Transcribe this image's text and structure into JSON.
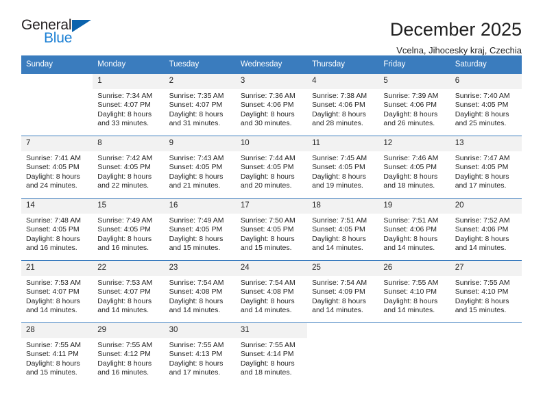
{
  "brand": {
    "name_top": "General",
    "name_bottom": "Blue",
    "triangle_icon": "triangle-logo-icon",
    "colors": {
      "dark": "#231f20",
      "blue": "#1a7fd4",
      "triangle": "#0b63ad"
    }
  },
  "header": {
    "title": "December 2025",
    "subtitle": "Vcelna, Jihocesky kraj, Czechia"
  },
  "theme": {
    "header_bg": "#3a7cbe",
    "header_text": "#ffffff",
    "daynum_bg": "#f2f2f2",
    "row_border": "#3a7cbe"
  },
  "weekday_headers": [
    "Sunday",
    "Monday",
    "Tuesday",
    "Wednesday",
    "Thursday",
    "Friday",
    "Saturday"
  ],
  "labels": {
    "sunrise_prefix": "Sunrise:",
    "sunset_prefix": "Sunset:",
    "daylight_prefix": "Daylight:"
  },
  "weeks": [
    [
      {
        "day": "",
        "empty": true
      },
      {
        "day": "1",
        "sunrise": "Sunrise: 7:34 AM",
        "sunset": "Sunset: 4:07 PM",
        "daylight_line1": "Daylight: 8 hours",
        "daylight_line2": "and 33 minutes."
      },
      {
        "day": "2",
        "sunrise": "Sunrise: 7:35 AM",
        "sunset": "Sunset: 4:07 PM",
        "daylight_line1": "Daylight: 8 hours",
        "daylight_line2": "and 31 minutes."
      },
      {
        "day": "3",
        "sunrise": "Sunrise: 7:36 AM",
        "sunset": "Sunset: 4:06 PM",
        "daylight_line1": "Daylight: 8 hours",
        "daylight_line2": "and 30 minutes."
      },
      {
        "day": "4",
        "sunrise": "Sunrise: 7:38 AM",
        "sunset": "Sunset: 4:06 PM",
        "daylight_line1": "Daylight: 8 hours",
        "daylight_line2": "and 28 minutes."
      },
      {
        "day": "5",
        "sunrise": "Sunrise: 7:39 AM",
        "sunset": "Sunset: 4:06 PM",
        "daylight_line1": "Daylight: 8 hours",
        "daylight_line2": "and 26 minutes."
      },
      {
        "day": "6",
        "sunrise": "Sunrise: 7:40 AM",
        "sunset": "Sunset: 4:05 PM",
        "daylight_line1": "Daylight: 8 hours",
        "daylight_line2": "and 25 minutes."
      }
    ],
    [
      {
        "day": "7",
        "sunrise": "Sunrise: 7:41 AM",
        "sunset": "Sunset: 4:05 PM",
        "daylight_line1": "Daylight: 8 hours",
        "daylight_line2": "and 24 minutes."
      },
      {
        "day": "8",
        "sunrise": "Sunrise: 7:42 AM",
        "sunset": "Sunset: 4:05 PM",
        "daylight_line1": "Daylight: 8 hours",
        "daylight_line2": "and 22 minutes."
      },
      {
        "day": "9",
        "sunrise": "Sunrise: 7:43 AM",
        "sunset": "Sunset: 4:05 PM",
        "daylight_line1": "Daylight: 8 hours",
        "daylight_line2": "and 21 minutes."
      },
      {
        "day": "10",
        "sunrise": "Sunrise: 7:44 AM",
        "sunset": "Sunset: 4:05 PM",
        "daylight_line1": "Daylight: 8 hours",
        "daylight_line2": "and 20 minutes."
      },
      {
        "day": "11",
        "sunrise": "Sunrise: 7:45 AM",
        "sunset": "Sunset: 4:05 PM",
        "daylight_line1": "Daylight: 8 hours",
        "daylight_line2": "and 19 minutes."
      },
      {
        "day": "12",
        "sunrise": "Sunrise: 7:46 AM",
        "sunset": "Sunset: 4:05 PM",
        "daylight_line1": "Daylight: 8 hours",
        "daylight_line2": "and 18 minutes."
      },
      {
        "day": "13",
        "sunrise": "Sunrise: 7:47 AM",
        "sunset": "Sunset: 4:05 PM",
        "daylight_line1": "Daylight: 8 hours",
        "daylight_line2": "and 17 minutes."
      }
    ],
    [
      {
        "day": "14",
        "sunrise": "Sunrise: 7:48 AM",
        "sunset": "Sunset: 4:05 PM",
        "daylight_line1": "Daylight: 8 hours",
        "daylight_line2": "and 16 minutes."
      },
      {
        "day": "15",
        "sunrise": "Sunrise: 7:49 AM",
        "sunset": "Sunset: 4:05 PM",
        "daylight_line1": "Daylight: 8 hours",
        "daylight_line2": "and 16 minutes."
      },
      {
        "day": "16",
        "sunrise": "Sunrise: 7:49 AM",
        "sunset": "Sunset: 4:05 PM",
        "daylight_line1": "Daylight: 8 hours",
        "daylight_line2": "and 15 minutes."
      },
      {
        "day": "17",
        "sunrise": "Sunrise: 7:50 AM",
        "sunset": "Sunset: 4:05 PM",
        "daylight_line1": "Daylight: 8 hours",
        "daylight_line2": "and 15 minutes."
      },
      {
        "day": "18",
        "sunrise": "Sunrise: 7:51 AM",
        "sunset": "Sunset: 4:05 PM",
        "daylight_line1": "Daylight: 8 hours",
        "daylight_line2": "and 14 minutes."
      },
      {
        "day": "19",
        "sunrise": "Sunrise: 7:51 AM",
        "sunset": "Sunset: 4:06 PM",
        "daylight_line1": "Daylight: 8 hours",
        "daylight_line2": "and 14 minutes."
      },
      {
        "day": "20",
        "sunrise": "Sunrise: 7:52 AM",
        "sunset": "Sunset: 4:06 PM",
        "daylight_line1": "Daylight: 8 hours",
        "daylight_line2": "and 14 minutes."
      }
    ],
    [
      {
        "day": "21",
        "sunrise": "Sunrise: 7:53 AM",
        "sunset": "Sunset: 4:07 PM",
        "daylight_line1": "Daylight: 8 hours",
        "daylight_line2": "and 14 minutes."
      },
      {
        "day": "22",
        "sunrise": "Sunrise: 7:53 AM",
        "sunset": "Sunset: 4:07 PM",
        "daylight_line1": "Daylight: 8 hours",
        "daylight_line2": "and 14 minutes."
      },
      {
        "day": "23",
        "sunrise": "Sunrise: 7:54 AM",
        "sunset": "Sunset: 4:08 PM",
        "daylight_line1": "Daylight: 8 hours",
        "daylight_line2": "and 14 minutes."
      },
      {
        "day": "24",
        "sunrise": "Sunrise: 7:54 AM",
        "sunset": "Sunset: 4:08 PM",
        "daylight_line1": "Daylight: 8 hours",
        "daylight_line2": "and 14 minutes."
      },
      {
        "day": "25",
        "sunrise": "Sunrise: 7:54 AM",
        "sunset": "Sunset: 4:09 PM",
        "daylight_line1": "Daylight: 8 hours",
        "daylight_line2": "and 14 minutes."
      },
      {
        "day": "26",
        "sunrise": "Sunrise: 7:55 AM",
        "sunset": "Sunset: 4:10 PM",
        "daylight_line1": "Daylight: 8 hours",
        "daylight_line2": "and 14 minutes."
      },
      {
        "day": "27",
        "sunrise": "Sunrise: 7:55 AM",
        "sunset": "Sunset: 4:10 PM",
        "daylight_line1": "Daylight: 8 hours",
        "daylight_line2": "and 15 minutes."
      }
    ],
    [
      {
        "day": "28",
        "sunrise": "Sunrise: 7:55 AM",
        "sunset": "Sunset: 4:11 PM",
        "daylight_line1": "Daylight: 8 hours",
        "daylight_line2": "and 15 minutes."
      },
      {
        "day": "29",
        "sunrise": "Sunrise: 7:55 AM",
        "sunset": "Sunset: 4:12 PM",
        "daylight_line1": "Daylight: 8 hours",
        "daylight_line2": "and 16 minutes."
      },
      {
        "day": "30",
        "sunrise": "Sunrise: 7:55 AM",
        "sunset": "Sunset: 4:13 PM",
        "daylight_line1": "Daylight: 8 hours",
        "daylight_line2": "and 17 minutes."
      },
      {
        "day": "31",
        "sunrise": "Sunrise: 7:55 AM",
        "sunset": "Sunset: 4:14 PM",
        "daylight_line1": "Daylight: 8 hours",
        "daylight_line2": "and 18 minutes."
      },
      {
        "day": "",
        "empty": true
      },
      {
        "day": "",
        "empty": true
      },
      {
        "day": "",
        "empty": true
      }
    ]
  ]
}
